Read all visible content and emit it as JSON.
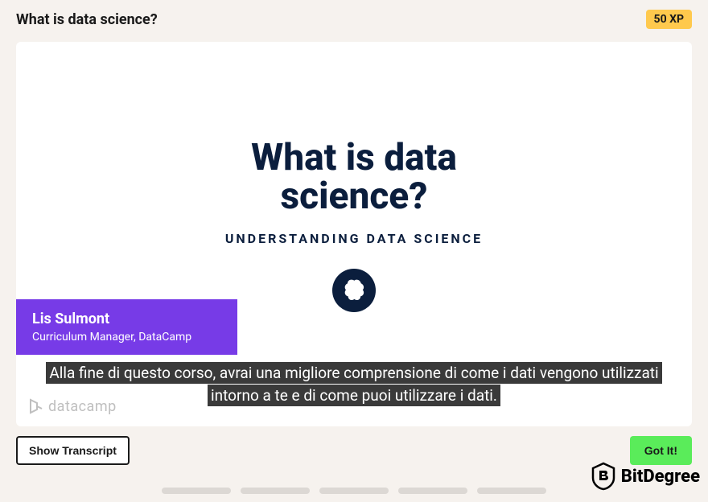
{
  "header": {
    "title": "What is data science?",
    "xp_label": "50 XP"
  },
  "slide": {
    "title": "What is data science?",
    "subtitle": "UNDERSTANDING DATA SCIENCE"
  },
  "instructor": {
    "name": "Lis Sulmont",
    "title": "Curriculum Manager, DataCamp"
  },
  "caption": {
    "text": "Alla fine di questo corso, avrai una migliore comprensione di come i dati vengono utilizzati intorno a te e di come puoi utilizzare i dati."
  },
  "brand": {
    "datacamp": "datacamp",
    "bitdegree": "BitDegree"
  },
  "buttons": {
    "transcript": "Show Transcript",
    "gotit": "Got It!"
  }
}
